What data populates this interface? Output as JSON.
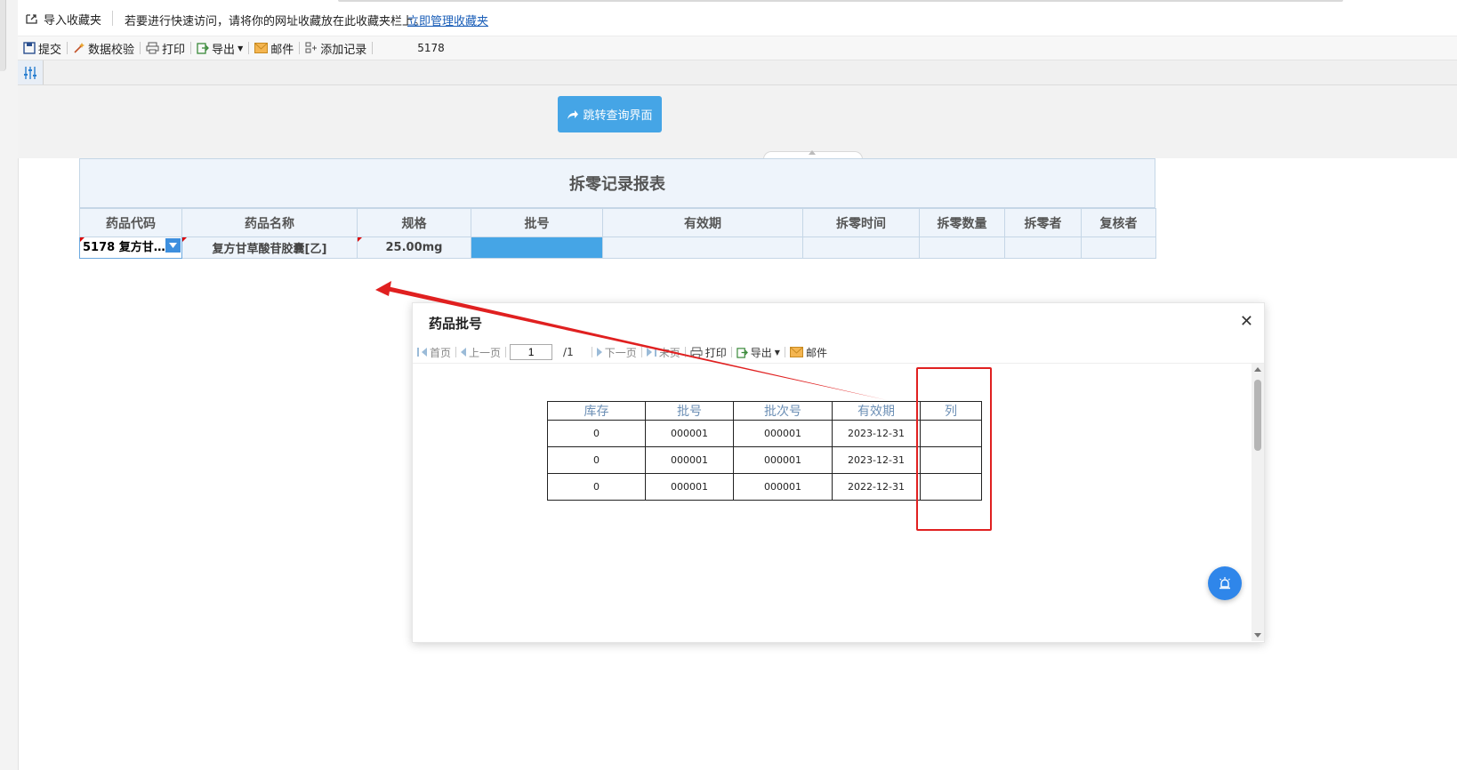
{
  "bookmarks": {
    "import_label": "导入收藏夹",
    "hint": "若要进行快速访问，请将你的网址收藏放在此收藏夹栏上。",
    "manage_link": "立即管理收藏夹"
  },
  "toolbar": {
    "submit": "提交",
    "validate": "数据校验",
    "print": "打印",
    "export": "导出",
    "mail": "邮件",
    "add_record": "添加记录",
    "record_id": "5178"
  },
  "query": {
    "jump_label": "跳转查询界面"
  },
  "report": {
    "title": "拆零记录报表",
    "headers": [
      "药品代码",
      "药品名称",
      "规格",
      "批号",
      "有效期",
      "拆零时间",
      "拆零数量",
      "拆零者",
      "复核者"
    ],
    "row": {
      "code": "5178 复方甘…",
      "name": "复方甘草酸苷胶囊[乙]",
      "spec": "25.00mg",
      "batch": "",
      "expiry": "",
      "split_time": "",
      "split_qty": "",
      "splitter": "",
      "reviewer": ""
    }
  },
  "dialog": {
    "title": "药品批号",
    "nav": {
      "first": "首页",
      "prev": "上一页",
      "page": "1",
      "total": "/1",
      "next": "下一页",
      "last": "末页",
      "print": "打印",
      "export": "导出",
      "mail": "邮件"
    },
    "table": {
      "headers": [
        "库存",
        "批号",
        "批次号",
        "有效期",
        "列"
      ],
      "rows": [
        [
          "0",
          "000001",
          "000001",
          "2023-12-31",
          ""
        ],
        [
          "0",
          "000001",
          "000001",
          "2023-12-31",
          ""
        ],
        [
          "0",
          "000001",
          "000001",
          "2022-12-31",
          ""
        ]
      ]
    }
  },
  "colors": {
    "accent": "#45a5e6",
    "annotation_red": "#e02020",
    "fab_blue": "#2f86ea",
    "header_bg": "#eef4fb"
  }
}
